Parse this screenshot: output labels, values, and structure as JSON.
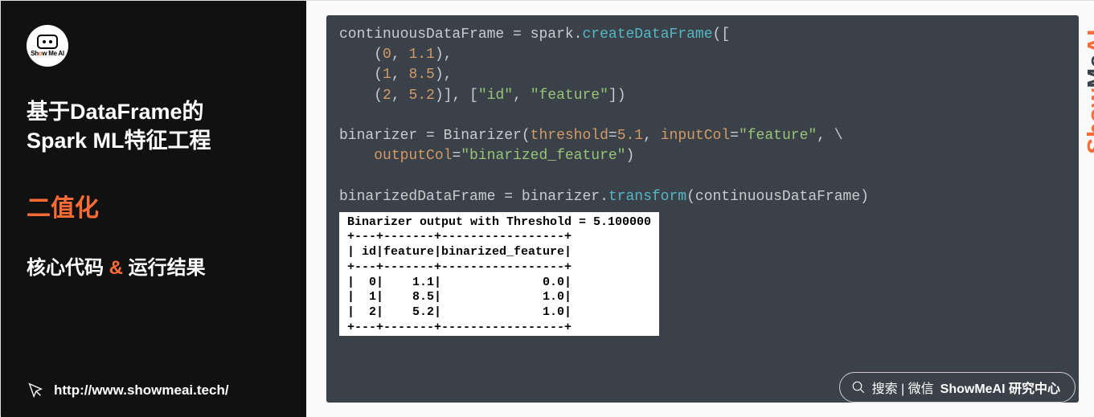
{
  "sidebar": {
    "logo_text_pre": "Sh",
    "logo_text_o": "o",
    "logo_text_post": "w Me AI",
    "title_line1": "基于DataFrame的",
    "title_line2": "Spark ML特征工程",
    "subtitle": "二值化",
    "section_pre": "核心代码 ",
    "section_amp": "&",
    "section_post": " 运行结果",
    "url": "http://www.showmeai.tech/"
  },
  "code": {
    "l1a": "continuousDataFrame ",
    "l1b": "=",
    "l1c": " spark.",
    "l1d": "createDataFrame",
    "l1e": "([",
    "l2a": "    (",
    "l2b": "0",
    "l2c": ", ",
    "l2d": "1.1",
    "l2e": "),",
    "l3a": "    (",
    "l3b": "1",
    "l3c": ", ",
    "l3d": "8.5",
    "l3e": "),",
    "l4a": "    (",
    "l4b": "2",
    "l4c": ", ",
    "l4d": "5.2",
    "l4e": ")], [",
    "l4f": "\"id\"",
    "l4g": ", ",
    "l4h": "\"feature\"",
    "l4i": "])",
    "l6a": "binarizer ",
    "l6b": "=",
    "l6c": " Binarizer(",
    "l6d": "threshold",
    "l6e": "=",
    "l6f": "5.1",
    "l6g": ", ",
    "l6h": "inputCol",
    "l6i": "=",
    "l6j": "\"feature\"",
    "l6k": ", \\",
    "l7a": "    ",
    "l7b": "outputCol",
    "l7c": "=",
    "l7d": "\"binarized_feature\"",
    "l7e": ")",
    "l9a": "binarizedDataFrame ",
    "l9b": "=",
    "l9c": " binarizer.",
    "l9d": "transform",
    "l9e": "(continuousDataFrame)"
  },
  "output": {
    "title": "Binarizer output with Threshold = 5.100000",
    "sep": "+---+-------+-----------------+",
    "head": "| id|feature|binarized_feature|",
    "rows": [
      "|  0|    1.1|              0.0|",
      "|  1|    8.5|              1.0|",
      "|  2|    5.2|              1.0|"
    ]
  },
  "chart_data": {
    "type": "table",
    "title": "Binarizer output with Threshold = 5.100000",
    "threshold": 5.1,
    "columns": [
      "id",
      "feature",
      "binarized_feature"
    ],
    "rows": [
      {
        "id": 0,
        "feature": 1.1,
        "binarized_feature": 0.0
      },
      {
        "id": 1,
        "feature": 8.5,
        "binarized_feature": 1.0
      },
      {
        "id": 2,
        "feature": 5.2,
        "binarized_feature": 1.0
      }
    ]
  },
  "watermark": {
    "show": "Show",
    "me": "Me",
    "ai": "AI"
  },
  "search": {
    "prefix": "搜索 | 微信 ",
    "bold": "ShowMeAI 研究中心"
  }
}
